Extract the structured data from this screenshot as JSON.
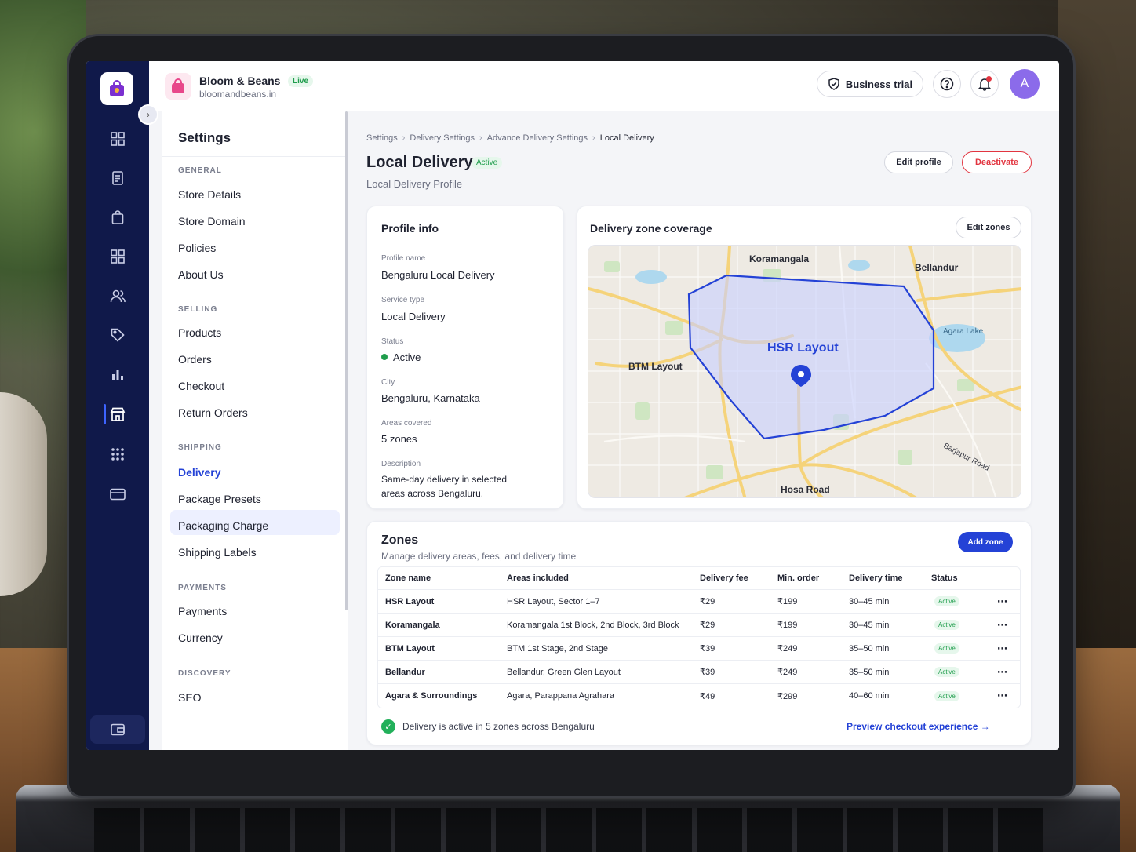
{
  "store": {
    "name": "Bloom & Beans",
    "domain": "bloomandbeans.in",
    "live_badge": "Live"
  },
  "topbar": {
    "trial_label": "Business trial",
    "avatar_initial": "A"
  },
  "rail": {
    "icons": [
      "dashboard-icon",
      "orders-icon",
      "bag-icon",
      "apps-icon",
      "customers-icon",
      "tag-icon",
      "analytics-icon",
      "store-icon",
      "grid-dots-icon",
      "card-icon"
    ],
    "active": "store-icon"
  },
  "settings": {
    "title": "Settings",
    "sections": [
      {
        "label": "GENERAL",
        "items": [
          "Store Details",
          "Store Domain",
          "Policies",
          "About Us"
        ]
      },
      {
        "label": "SELLING",
        "items": [
          "Products",
          "Orders",
          "Checkout",
          "Return Orders"
        ]
      },
      {
        "label": "SHIPPING",
        "items": [
          "Delivery",
          "Package Presets",
          "Packaging Charge",
          "Shipping Labels"
        ]
      },
      {
        "label": "PAYMENTS",
        "items": [
          "Payments",
          "Currency"
        ]
      },
      {
        "label": "DISCOVERY",
        "items": [
          "SEO"
        ]
      }
    ],
    "active_item": "Delivery"
  },
  "breadcrumb": [
    "Settings",
    "Delivery Settings",
    "Advance Delivery Settings",
    "Local Delivery"
  ],
  "page": {
    "title": "Local Delivery",
    "status_badge": "Active",
    "subtitle": "Local Delivery Profile",
    "edit_profile_label": "Edit profile",
    "deactivate_label": "Deactivate"
  },
  "profile": {
    "heading": "Profile info",
    "fields": [
      {
        "label": "Profile name",
        "value": "Bengaluru Local Delivery"
      },
      {
        "label": "Service type",
        "value": "Local Delivery"
      },
      {
        "label": "Status",
        "value": "Active"
      },
      {
        "label": "City",
        "value": "Bengaluru, Karnataka"
      },
      {
        "label": "Areas covered",
        "value": "5 zones"
      },
      {
        "label": "Description",
        "value": "Same-day delivery in selected areas across Bengaluru."
      }
    ],
    "description_lines": [
      "Same-day delivery in selected",
      "areas across Bengaluru."
    ]
  },
  "coverage": {
    "heading": "Delivery zone coverage",
    "edit_zones_label": "Edit zones",
    "map_labels": {
      "koramangala": "Koramangala",
      "bellandur": "Bellandur",
      "agara_lake": "Agara Lake",
      "hsr": "HSR Layout",
      "btm": "BTM Layout",
      "sarjapur": "Sarjapur Road",
      "hosa": "Hosa Road"
    },
    "colors": {
      "zone_fill": "#c8cfff",
      "zone_stroke": "#2442d6",
      "map_bg": "#eeeae3",
      "park": "#cfe6c2",
      "water": "#aed8ee",
      "road": "#f5d37a"
    }
  },
  "zones": {
    "title": "Zones",
    "subtitle": "Manage delivery areas, fees, and delivery time",
    "add_label": "Add zone",
    "columns": [
      "Zone name",
      "Areas included",
      "Delivery fee",
      "Min. order",
      "Delivery time",
      "Status"
    ],
    "rows": [
      {
        "name": "HSR Layout",
        "areas": "HSR Layout, Sector 1–7",
        "fee": "₹29",
        "min": "₹199",
        "time": "30–45 min",
        "status": "Active"
      },
      {
        "name": "Koramangala",
        "areas": "Koramangala 1st Block, 2nd Block, 3rd Block",
        "fee": "₹29",
        "min": "₹199",
        "time": "30–45 min",
        "status": "Active"
      },
      {
        "name": "BTM Layout",
        "areas": "BTM 1st Stage, 2nd Stage",
        "fee": "₹39",
        "min": "₹249",
        "time": "35–50 min",
        "status": "Active"
      },
      {
        "name": "Bellandur",
        "areas": "Bellandur, Green Glen Layout",
        "fee": "₹39",
        "min": "₹249",
        "time": "35–50 min",
        "status": "Active"
      },
      {
        "name": "Agara & Surroundings",
        "areas": "Agara, Parappana Agrahara",
        "fee": "₹49",
        "min": "₹299",
        "time": "40–60 min",
        "status": "Active"
      }
    ],
    "footer_text": "Delivery is active in 5 zones across Bengaluru",
    "preview_link": "Preview checkout experience"
  }
}
